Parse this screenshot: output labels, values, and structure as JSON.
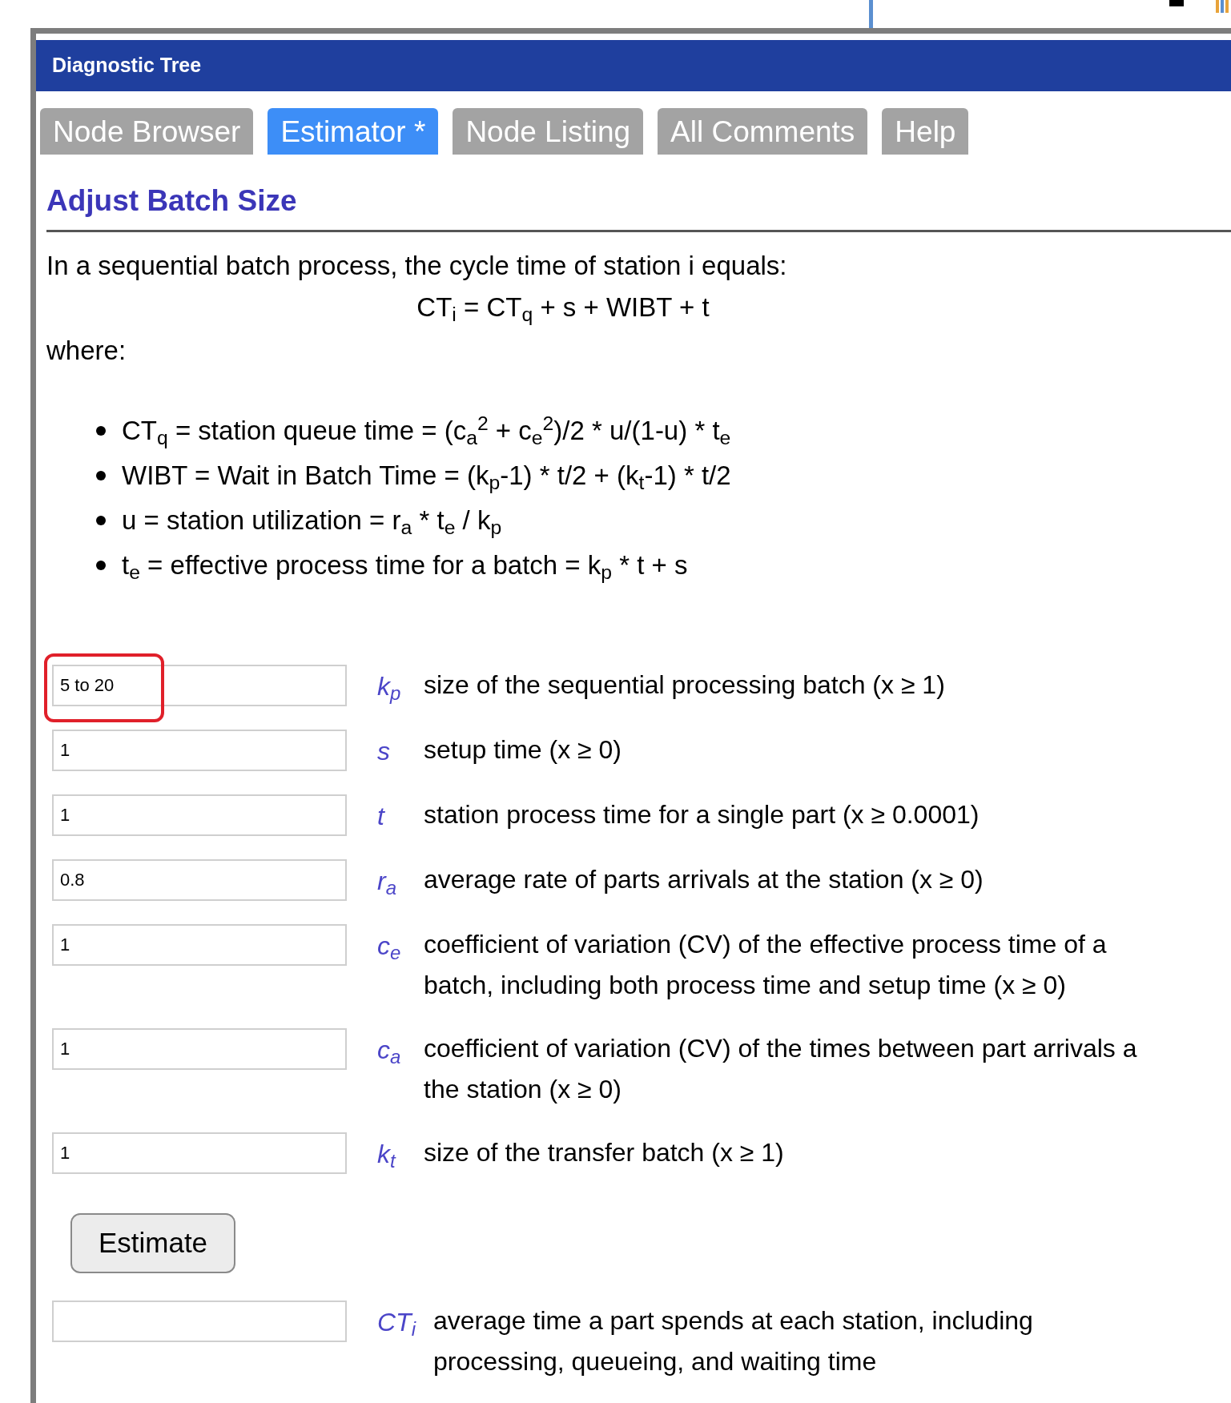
{
  "window": {
    "title": "Diagnostic Tree"
  },
  "tabs": [
    {
      "label": "Node Browser",
      "selected": false
    },
    {
      "label": "Estimator *",
      "selected": true
    },
    {
      "label": "Node Listing",
      "selected": false
    },
    {
      "label": "All Comments",
      "selected": false
    },
    {
      "label": "Help",
      "selected": false
    }
  ],
  "heading": "Adjust Batch Size",
  "intro": "In a sequential batch process, the cycle time of station i equals:",
  "formula": "CT$_{i}$ = CT$_{q}$ + s + WIBT + t",
  "where": "where:",
  "definitions": [
    "CT$_{q}$ = station queue time = (c$_{a}$$^{2}$ + c$_{e}$$^{2}$)/2 * u/(1-u) * t$_{e}$",
    "WIBT = Wait in Batch Time = (k$_{p}$-1) * t/2 + (k$_{t}$-1) * t/2",
    "u = station utilization = r$_{a}$ * t$_{e}$ / k$_{p}$",
    "t$_{e}$ = effective process time for a batch = k$_{p}$ * t + s"
  ],
  "inputs": [
    {
      "value": "5 to 20",
      "highlighted": true,
      "symbol": "k$_{p}$",
      "description": [
        "size of the sequential processing batch (x ≥ 1)"
      ]
    },
    {
      "value": "1",
      "highlighted": false,
      "symbol": "s",
      "description": [
        "setup time (x ≥ 0)"
      ]
    },
    {
      "value": "1",
      "highlighted": false,
      "symbol": "t",
      "description": [
        "station process time for a single part (x ≥ 0.0001)"
      ]
    },
    {
      "value": "0.8",
      "highlighted": false,
      "symbol": "r$_{a}$",
      "description": [
        "average rate of parts arrivals at the station (x ≥ 0)"
      ]
    },
    {
      "value": "1",
      "highlighted": false,
      "symbol": "c$_{e}$",
      "description": [
        "coefficient of variation (CV) of the effective process time of a",
        "batch, including both process time and setup time (x ≥ 0)"
      ]
    },
    {
      "value": "1",
      "highlighted": false,
      "symbol": "c$_{a}$",
      "description": [
        "coefficient of variation (CV) of the times between part arrivals a",
        "the station (x ≥ 0)"
      ]
    },
    {
      "value": "1",
      "highlighted": false,
      "symbol": "k$_{t}$",
      "description": [
        "size of the transfer batch (x ≥ 1)"
      ]
    }
  ],
  "button": "Estimate",
  "output": {
    "symbol": "CT$_{i}$",
    "description": [
      "average time a part spends at each station, including",
      "processing, queueing, and waiting time"
    ]
  }
}
